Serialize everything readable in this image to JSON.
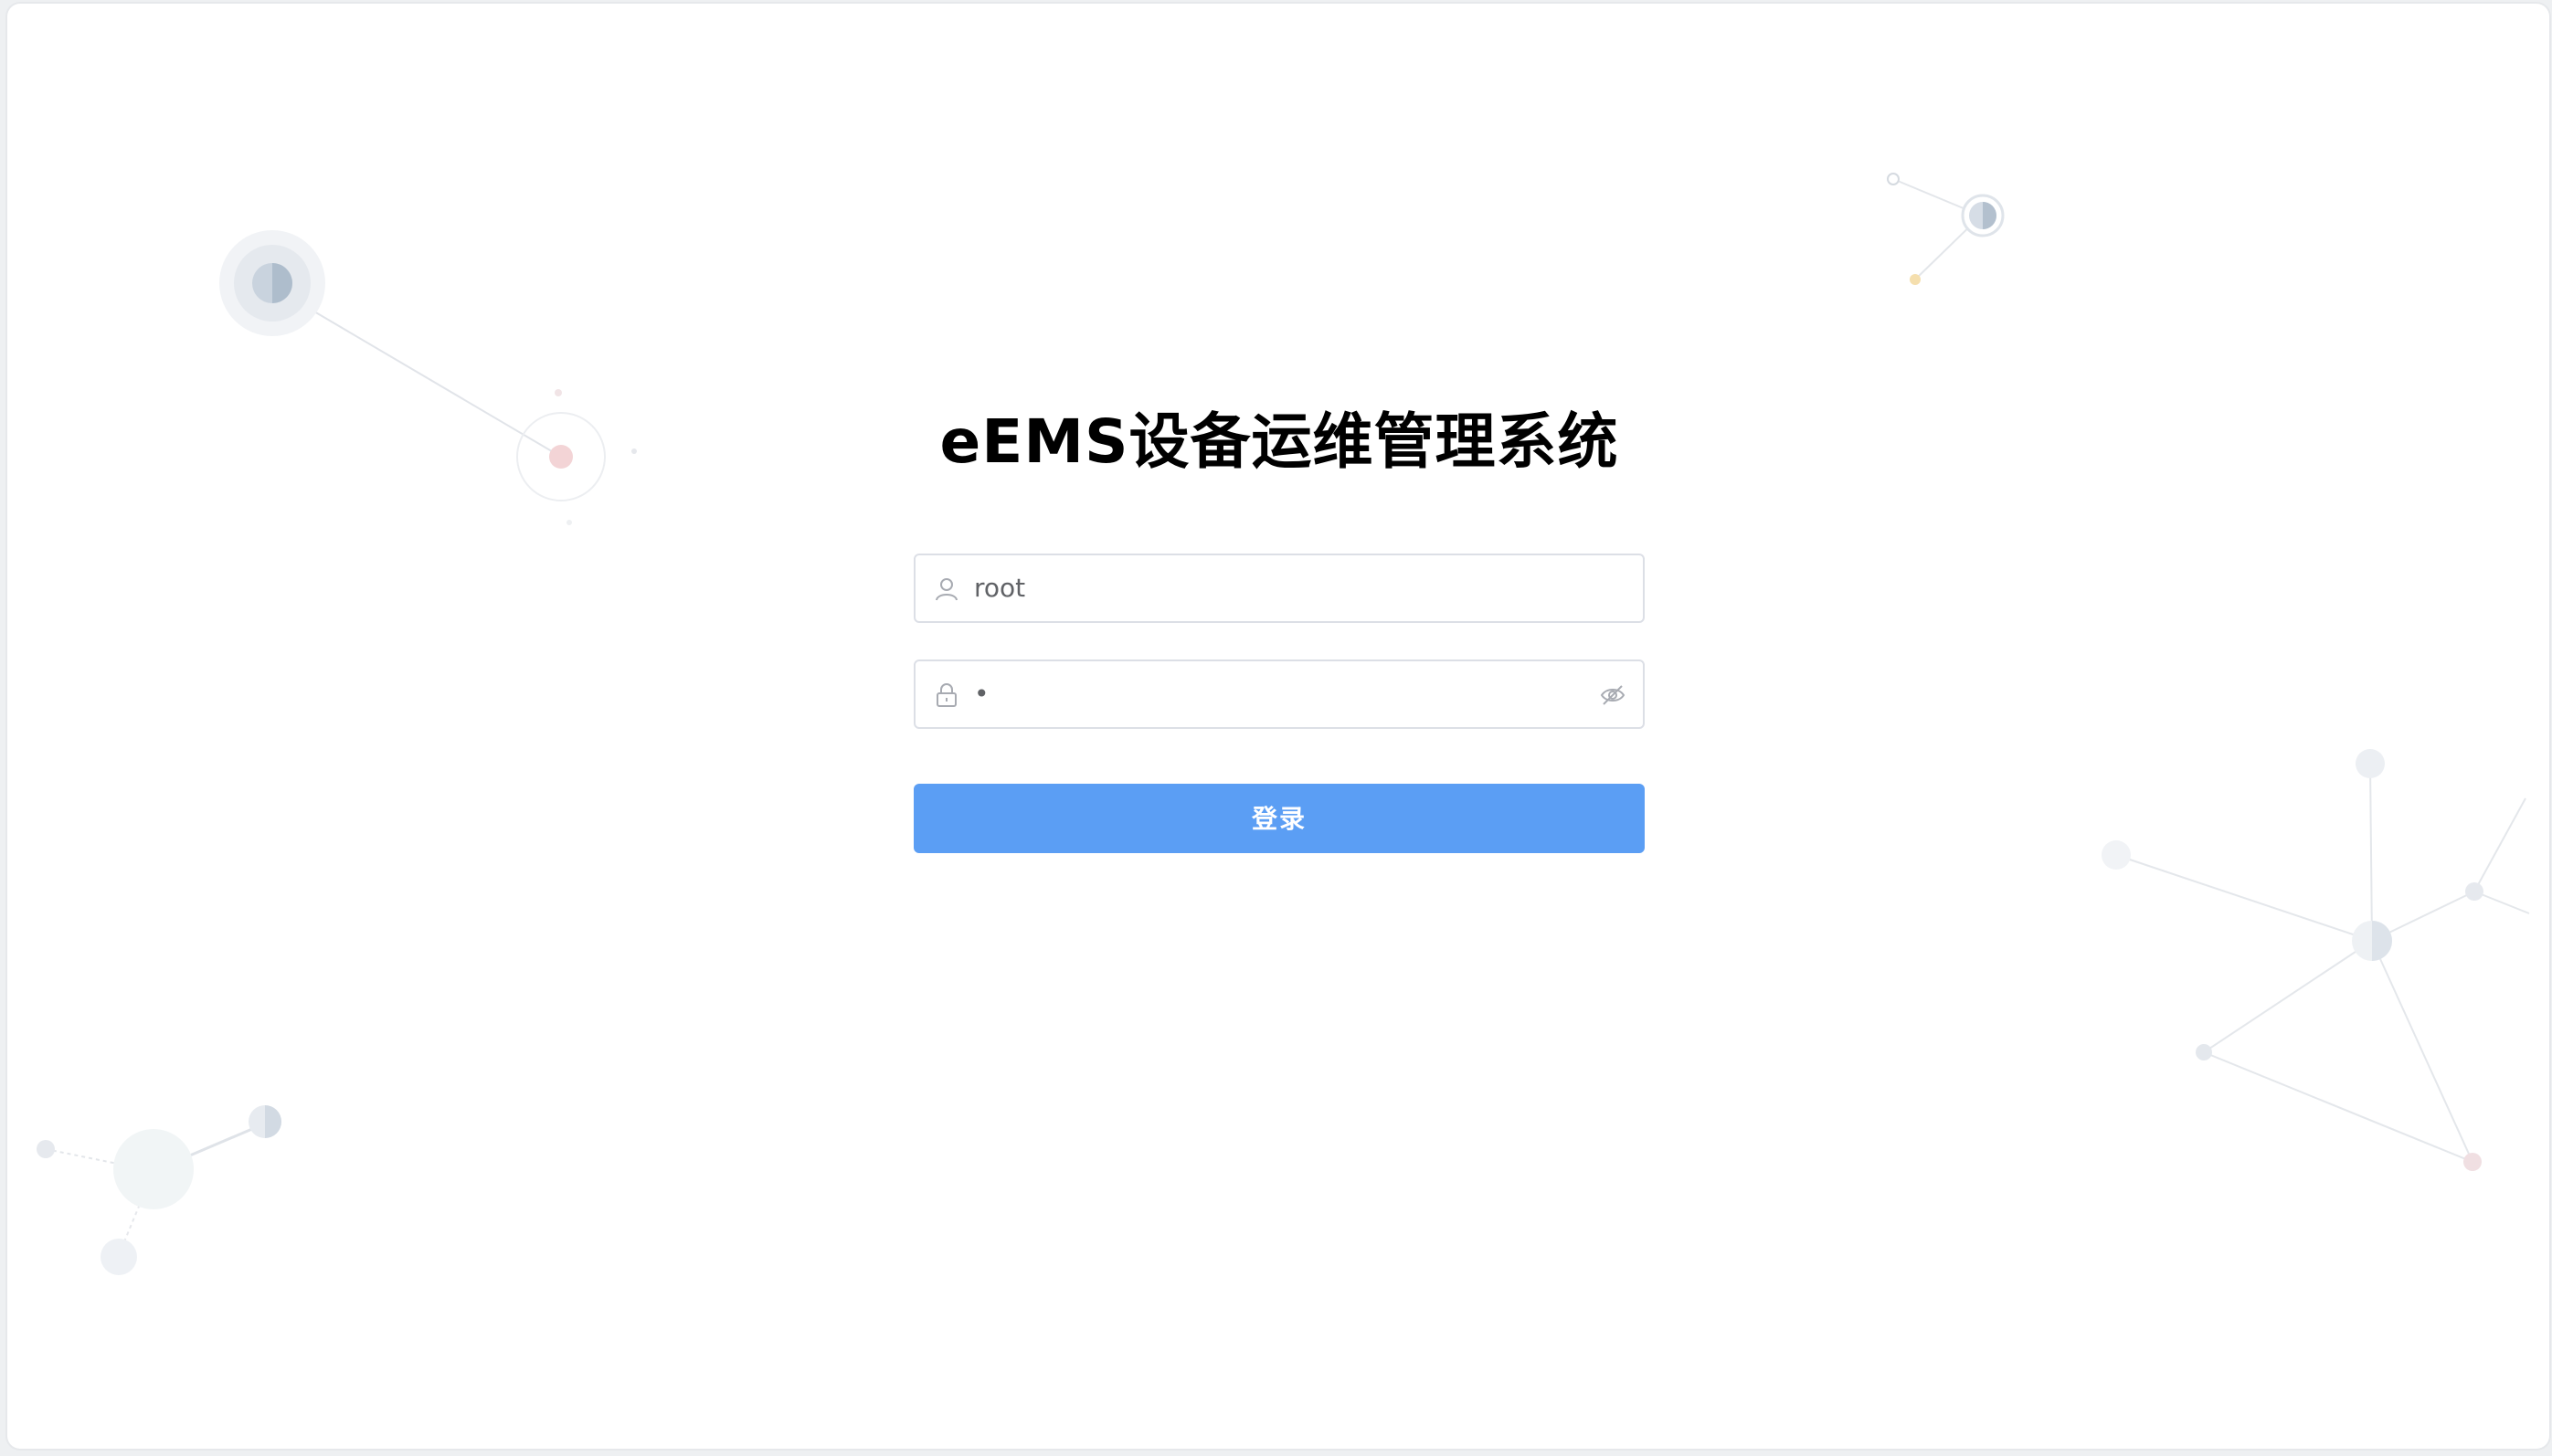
{
  "app": {
    "title": "eEMS设备运维管理系统"
  },
  "form": {
    "username": {
      "value": "root",
      "icon": "user-icon"
    },
    "password": {
      "masked_value": "•",
      "icon": "lock-icon",
      "toggle_icon": "eye-hidden-icon"
    },
    "submit_label": "登录"
  },
  "colors": {
    "primary_button": "#5b9ef4",
    "border": "#dcdfe6",
    "text": "#606266"
  }
}
